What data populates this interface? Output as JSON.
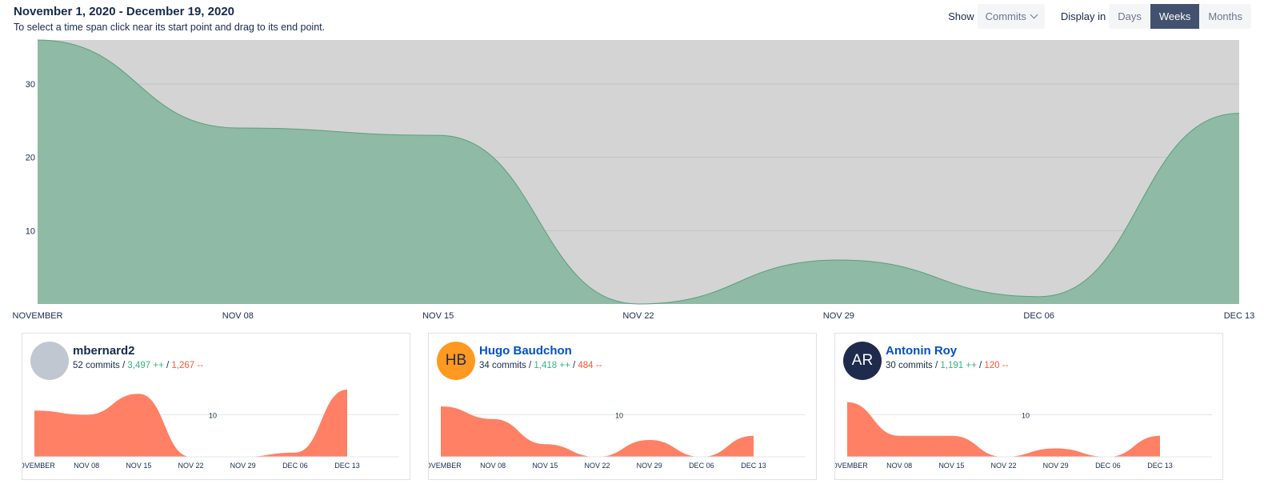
{
  "header": {
    "title": "November 1, 2020 - December 19, 2020",
    "subtitle": "To select a time span click near its start point and drag to its end point."
  },
  "controls": {
    "show_label": "Show",
    "show_value": "Commits",
    "display_label": "Display in",
    "display_options": [
      "Days",
      "Weeks",
      "Months"
    ],
    "display_selected": "Weeks"
  },
  "colors": {
    "main_fill": "#8fbaa5",
    "main_stroke": "#5a9e7e",
    "plot_background": "#d4d4d4",
    "contributor_fill": "#ff8064"
  },
  "chart_data": [
    {
      "type": "area",
      "x": [
        "NOVEMBER",
        "NOV 08",
        "NOV 15",
        "NOV 22",
        "NOV 29",
        "DEC 06",
        "DEC 13"
      ],
      "values": [
        36,
        24,
        23,
        0,
        6,
        1,
        26
      ],
      "yticks": [
        10,
        20,
        30
      ],
      "ylim": [
        0,
        36
      ],
      "grid": true
    },
    {
      "type": "area",
      "name": "mbernard2",
      "x": [
        "NOVEMBER",
        "NOV 08",
        "NOV 15",
        "NOV 22",
        "NOV 29",
        "DEC 06",
        "DEC 13"
      ],
      "values": [
        11,
        10,
        15,
        0,
        0,
        1,
        16
      ],
      "yticks": [
        10
      ],
      "ylim": [
        0,
        16
      ]
    },
    {
      "type": "area",
      "name": "Hugo Baudchon",
      "x": [
        "NOVEMBER",
        "NOV 08",
        "NOV 15",
        "NOV 22",
        "NOV 29",
        "DEC 06",
        "DEC 13"
      ],
      "values": [
        12,
        9,
        3,
        0,
        4,
        0,
        5
      ],
      "yticks": [
        10
      ],
      "ylim": [
        0,
        16
      ]
    },
    {
      "type": "area",
      "name": "Antonin Roy",
      "x": [
        "NOVEMBER",
        "NOV 08",
        "NOV 15",
        "NOV 22",
        "NOV 29",
        "DEC 06",
        "DEC 13"
      ],
      "values": [
        13,
        5,
        5,
        0,
        2,
        0,
        5
      ],
      "yticks": [
        10
      ],
      "ylim": [
        0,
        16
      ]
    }
  ],
  "contributors": [
    {
      "name": "mbernard2",
      "avatar_initials": "",
      "avatar_color": "#c1c7d0",
      "is_link": false,
      "commits": "52 commits",
      "additions": "3,497 ++",
      "deletions": "1,267 --"
    },
    {
      "name": "Hugo Baudchon",
      "avatar_initials": "HB",
      "avatar_color": "#ff991f",
      "is_link": true,
      "commits": "34 commits",
      "additions": "1,418 ++",
      "deletions": "484 --"
    },
    {
      "name": "Antonin Roy",
      "avatar_initials": "AR",
      "avatar_color": "#1f2b4d",
      "is_link": true,
      "commits": "30 commits",
      "additions": "1,191 ++",
      "deletions": "120 --"
    }
  ]
}
